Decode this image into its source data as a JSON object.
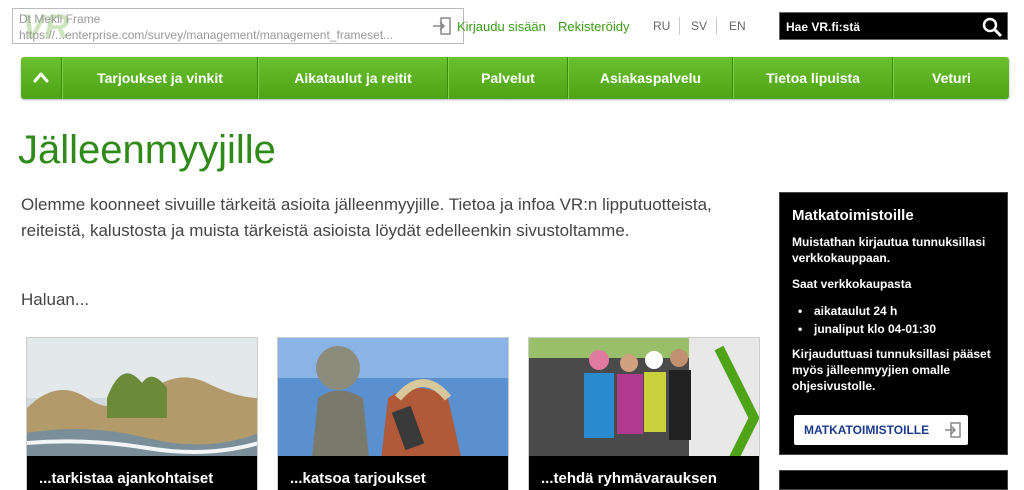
{
  "header": {
    "logo_text": "VR",
    "tooltip_line1": "Dt Mekli Frame",
    "tooltip_line2": "https://...enterprise.com/survey/management/management_frameset...",
    "login_label": "Kirjaudu sisään",
    "register_label": "Rekisteröidy",
    "languages": [
      "RU",
      "SV",
      "EN"
    ],
    "search_placeholder": "Hae VR.fi:stä"
  },
  "nav": {
    "items": [
      "Tarjoukset ja vinkit",
      "Aikataulut ja reitit",
      "Palvelut",
      "Asiakaspalvelu",
      "Tietoa lipuista",
      "Veturi"
    ]
  },
  "main": {
    "title": "Jälleenmyyjille",
    "intro": "Olemme koonneet sivuille tärkeitä asioita jälleenmyyjille. Tietoa ja infoa VR:n lipputuotteista, reiteistä, kalustosta ja muista tärkeistä asioista löydät edelleenkin sivustoltamme.",
    "want_label": "Haluan...",
    "cards": [
      {
        "label": "...tarkistaa ajankohtaiset"
      },
      {
        "label": "...katsoa tarjoukset"
      },
      {
        "label": "...tehdä ryhmävarauksen"
      }
    ]
  },
  "sidebar": {
    "title": "Matkatoimistoille",
    "p1": "Muistathan kirjautua tunnuksillasi verkkokauppaan.",
    "p2": "Saat verkkokaupasta",
    "bullets": [
      "aikataulut 24 h",
      "junaliput klo 04-01:30"
    ],
    "p3": "Kirjauduttuasi tunnuksillasi pääset myös jälleenmyyjien omalle ohjesivustolle.",
    "button_label": "MATKATOIMISTOILLE"
  },
  "colors": {
    "brand_green": "#4ea316",
    "title_green": "#2f8a1a",
    "link_green": "#3a9a14"
  }
}
